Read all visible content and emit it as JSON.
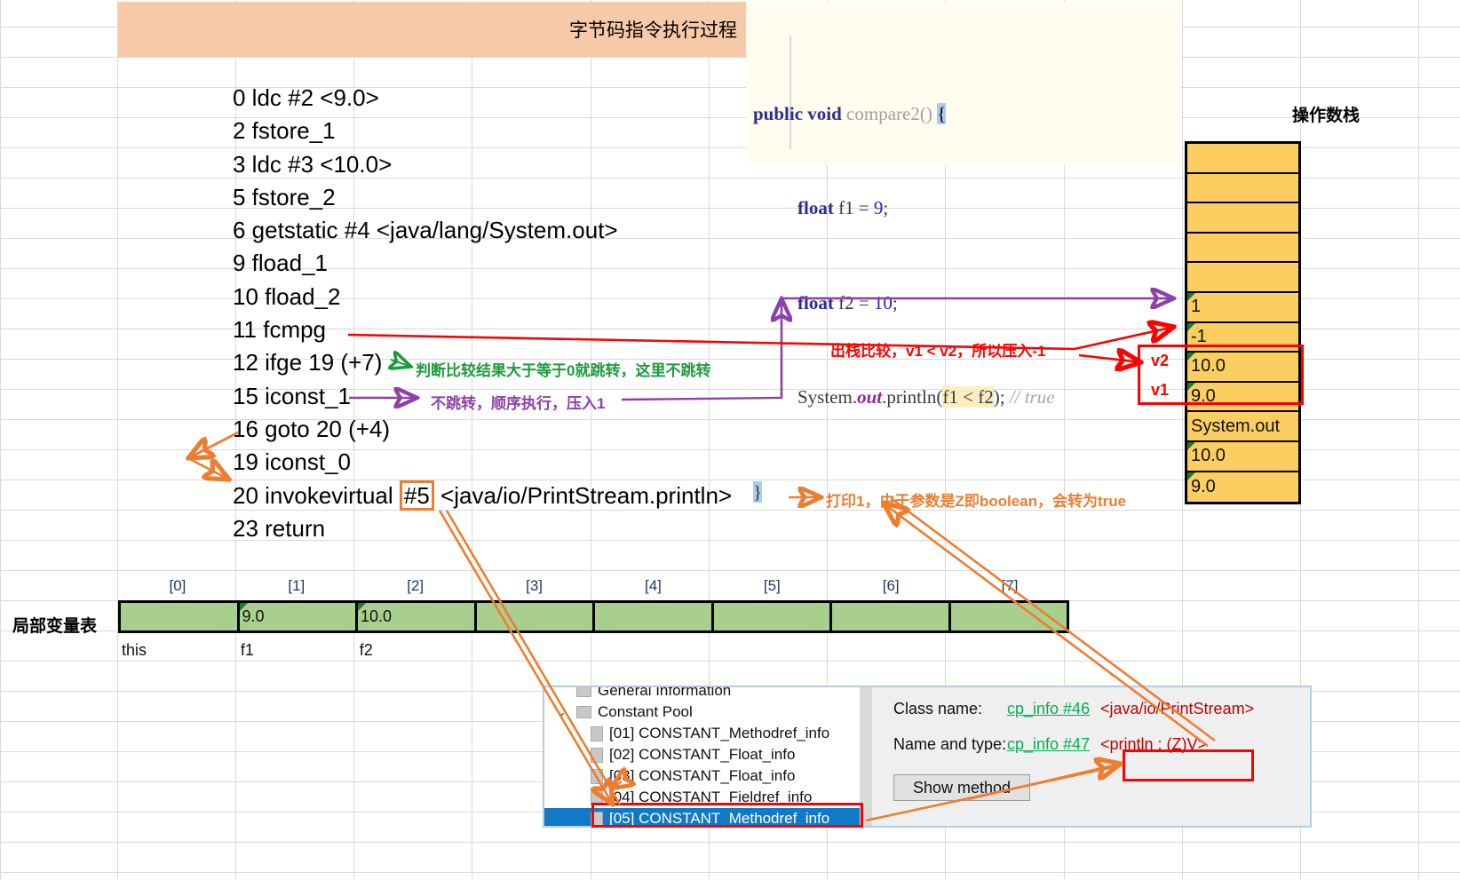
{
  "title_banner": {
    "text": "字节码指令执行过程"
  },
  "code_panel": {
    "line1_kw1": "public",
    "line1_kw2": "void",
    "line1_method": "compare2()",
    "line1_brace": "{",
    "line2_kw": "float",
    "line2_var": "f1 =",
    "line2_num": "9",
    "line2_semi": ";",
    "line3_kw": "float",
    "line3_var": "f2 =",
    "line3_num": "10",
    "line3_semi": ";",
    "line4_sys": "System.",
    "line4_out": "out",
    "line4_println": ".println(",
    "line4_expr": "f1 < f2",
    "line4_close": ");",
    "line4_comment": "// true",
    "line5_brace": "}"
  },
  "bytecode": {
    "lines": [
      "0 ldc #2 <9.0>",
      "2 fstore_1",
      "3 ldc #3 <10.0>",
      "5 fstore_2",
      "6 getstatic #4 <java/lang/System.out>",
      "9 fload_1",
      "10 fload_2",
      "11 fcmpg",
      "12 ifge 19 (+7)",
      "15 iconst_1",
      "16 goto 20 (+4)",
      "19 iconst_0"
    ],
    "invoke_prefix": "20 invokevirtual ",
    "invoke_ref": "#5",
    "invoke_suffix": " <java/io/PrintStream.println>",
    "last_line": "23 return"
  },
  "operand_stack": {
    "label": "操作数栈",
    "cells": [
      "",
      "",
      "",
      "",
      "",
      "1",
      "-1",
      "10.0",
      "9.0",
      "System.out",
      "10.0",
      "9.0"
    ],
    "v2_label": "v2",
    "v1_label": "v1",
    "fill_color": "#fcce61"
  },
  "local_variable_table": {
    "label": "局部变量表",
    "indices": [
      "[0]",
      "[1]",
      "[2]",
      "[3]",
      "[4]",
      "[5]",
      "[6]",
      "[7]"
    ],
    "values": [
      "",
      "9.0",
      "10.0",
      "",
      "",
      "",
      "",
      ""
    ],
    "names": [
      "this",
      "f1",
      "f2",
      "",
      "",
      "",
      "",
      ""
    ],
    "fill_color": "#a9cf8f"
  },
  "jclasslib": {
    "tree": [
      {
        "label": "General Information",
        "type": "folder",
        "indent": "root",
        "selected": false
      },
      {
        "label": "Constant Pool",
        "type": "folder",
        "indent": "root",
        "selected": false,
        "chevron": "⌄"
      },
      {
        "label": "[01] CONSTANT_Methodref_info",
        "type": "file",
        "indent": "child",
        "selected": false
      },
      {
        "label": "[02] CONSTANT_Float_info",
        "type": "file",
        "indent": "child",
        "selected": false
      },
      {
        "label": "[03] CONSTANT_Float_info",
        "type": "file",
        "indent": "child",
        "selected": false
      },
      {
        "label": "[04] CONSTANT_Fieldref_info",
        "type": "file",
        "indent": "child",
        "selected": false
      },
      {
        "label": "[05] CONSTANT_Methodref_info",
        "type": "file",
        "indent": "child",
        "selected": true
      }
    ],
    "detail": {
      "class_name_label": "Class name:",
      "class_name_link": "cp_info #46",
      "class_name_value": "<java/io/PrintStream>",
      "name_type_label": "Name and type:",
      "name_type_link": "cp_info #47",
      "name_type_value": "<println : (Z)V>",
      "show_method_button": "Show method"
    }
  },
  "annotations": {
    "green_ifge": "判断比较结果大于等于0就跳转，这里不跳转",
    "purple_iconst": "不跳转，顺序执行，压入1",
    "red_fcmpg": "出栈比较，v1 < v2，所以压入-1",
    "orange_invoke": "打印1，由于参数是Z即boolean，会转为true"
  },
  "colors": {
    "banner": "#f7c9a8",
    "stack": "#fcce61",
    "lvt": "#a9cf8f",
    "red": "#ff0000",
    "orange": "#ed7d31",
    "purple": "#8e3fa8",
    "green": "#1e9b3c"
  }
}
